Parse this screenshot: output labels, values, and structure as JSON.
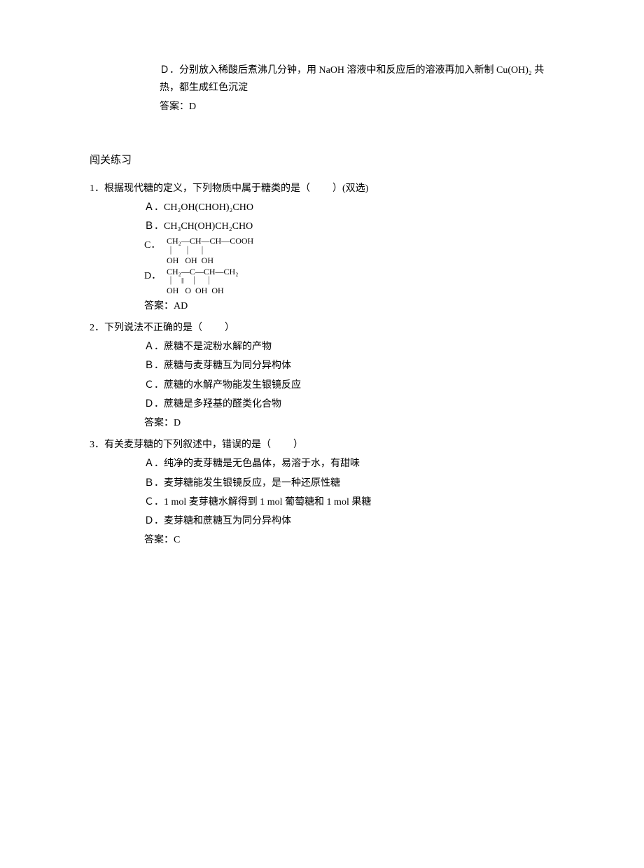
{
  "intro": {
    "option_d": "Ｄ．分别放入稀酸后煮沸几分钟，用 NaOH 溶液中和反应后的溶液再加入新制 Cu(OH)₂ 共热，都生成红色沉淀",
    "answer_label": "答案：",
    "answer_value": "D"
  },
  "section_title": "闯关练习",
  "q1": {
    "stem_prefix": "1．根据现代糖的定义，下列物质中属于糖类的是（",
    "stem_suffix": "）(双选)",
    "option_a_label": "Ａ．",
    "option_a_text": "CH₂OH(CHOH)₂CHO",
    "option_b_label": "Ｂ．",
    "option_b_text": "CH₃CH(OH)CH₂CHO",
    "option_c_label": "C．",
    "option_c_row1": "CH₂—CH—CH—COOH",
    "option_c_row2": "｜    ｜   ｜",
    "option_c_row3": "OH   OH  OH",
    "option_d_label": "D．",
    "option_d_row1": "CH₂—C—CH—CH₂",
    "option_d_row2": "｜   ‖   ｜   ｜",
    "option_d_row3": "OH   O  OH  OH",
    "answer_label": "答案：",
    "answer_value": "AD"
  },
  "q2": {
    "stem_prefix": "2．下列说法不正确的是（",
    "stem_suffix": "）",
    "option_a": "Ａ．蔗糖不是淀粉水解的产物",
    "option_b": "Ｂ．蔗糖与麦芽糖互为同分异构体",
    "option_c": "Ｃ．蔗糖的水解产物能发生银镜反应",
    "option_d": "Ｄ．蔗糖是多羟基的醛类化合物",
    "answer_label": "答案：",
    "answer_value": "D"
  },
  "q3": {
    "stem_prefix": "3．有关麦芽糖的下列叙述中，错误的是（",
    "stem_suffix": "）",
    "option_a": "Ａ．纯净的麦芽糖是无色晶体，易溶于水，有甜味",
    "option_b": "Ｂ．麦芽糖能发生银镜反应，是一种还原性糖",
    "option_c": "Ｃ．1 mol 麦芽糖水解得到 1 mol 葡萄糖和 1 mol 果糖",
    "option_d": "Ｄ．麦芽糖和蔗糖互为同分异构体",
    "answer_label": "答案：",
    "answer_value": "C"
  }
}
